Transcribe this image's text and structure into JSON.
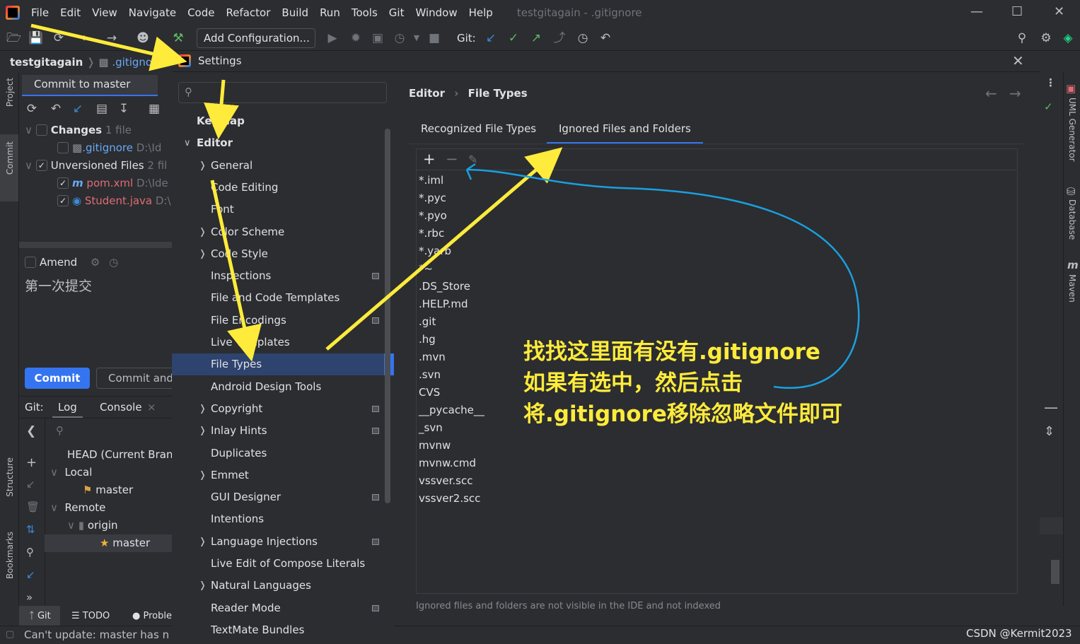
{
  "menu": {
    "items": [
      "File",
      "Edit",
      "View",
      "Navigate",
      "Code",
      "Refactor",
      "Build",
      "Run",
      "Tools",
      "Git",
      "Window",
      "Help"
    ],
    "title": "testgitagain - .gitignore"
  },
  "toolbar": {
    "add_config": "Add Configuration...",
    "git_label": "Git:"
  },
  "breadcrumb": {
    "project": "testgitagain",
    "file": ".gitignore"
  },
  "left_strip": {
    "project": "Project",
    "commit": "Commit",
    "structure": "Structure",
    "bookmarks": "Bookmarks"
  },
  "commit_pane": {
    "tab": "Commit to master",
    "changes": {
      "label": "Changes",
      "count": "1 file",
      "file": ".gitignore",
      "path": "D:\\Id"
    },
    "unversioned": {
      "label": "Unversioned Files",
      "count": "2 fil",
      "files": [
        {
          "name": "pom.xml",
          "path": "D:\\Ide"
        },
        {
          "name": "Student.java",
          "path": "D:\\"
        }
      ]
    },
    "amend": "Amend",
    "message": "第一次提交",
    "commit_btn": "Commit",
    "commit_and_btn": "Commit and"
  },
  "git_panel": {
    "git": "Git:",
    "tabs": [
      "Log",
      "Console"
    ],
    "head": "HEAD (Current Branc",
    "local": "Local",
    "local_master": "master",
    "remote": "Remote",
    "origin": "origin",
    "remote_master": "master"
  },
  "bottom_tabs": {
    "git": "Git",
    "todo": "TODO",
    "problems": "Proble"
  },
  "status": {
    "text": "Can't update: master has no",
    "watermark": "CSDN @Kermit2023"
  },
  "settings": {
    "title": "Settings",
    "tree": [
      "Keymap",
      "Editor",
      "General",
      "Code Editing",
      "Font",
      "Color Scheme",
      "Code Style",
      "Inspections",
      "File and Code Templates",
      "File Encodings",
      "Live Templates",
      "File Types",
      "Android Design Tools",
      "Copyright",
      "Inlay Hints",
      "Duplicates",
      "Emmet",
      "GUI Designer",
      "Intentions",
      "Language Injections",
      "Live Edit of Compose Literals",
      "Natural Languages",
      "Reader Mode",
      "TextMate Bundles"
    ],
    "breadcrumb": [
      "Editor",
      "File Types"
    ],
    "tabs": [
      "Recognized File Types",
      "Ignored Files and Folders"
    ],
    "ignored": [
      "*.iml",
      "*.pyc",
      "*.pyo",
      "*.rbc",
      "*.yarb",
      "*~",
      ".DS_Store",
      ".HELP.md",
      ".git",
      ".hg",
      ".mvn",
      ".svn",
      "CVS",
      "__pycache__",
      "_svn",
      "mvnw",
      "mvnw.cmd",
      "vssver.scc",
      "vssver2.scc"
    ],
    "hint": "Ignored files and folders are not visible in the IDE and not indexed"
  },
  "right_tools": {
    "uml": "UML Generator",
    "database": "Database",
    "maven": "Maven"
  },
  "annotation": {
    "line1": "找找这里面有没有.gitignore",
    "line2": "如果有选中，然后点击",
    "line3": "将.gitignore移除忽略文件即可"
  },
  "colors": {
    "accent": "#3574f0",
    "annotation": "#ffeb3b",
    "arrow": "#ffeb3b",
    "curve": "#1a9fe0"
  }
}
